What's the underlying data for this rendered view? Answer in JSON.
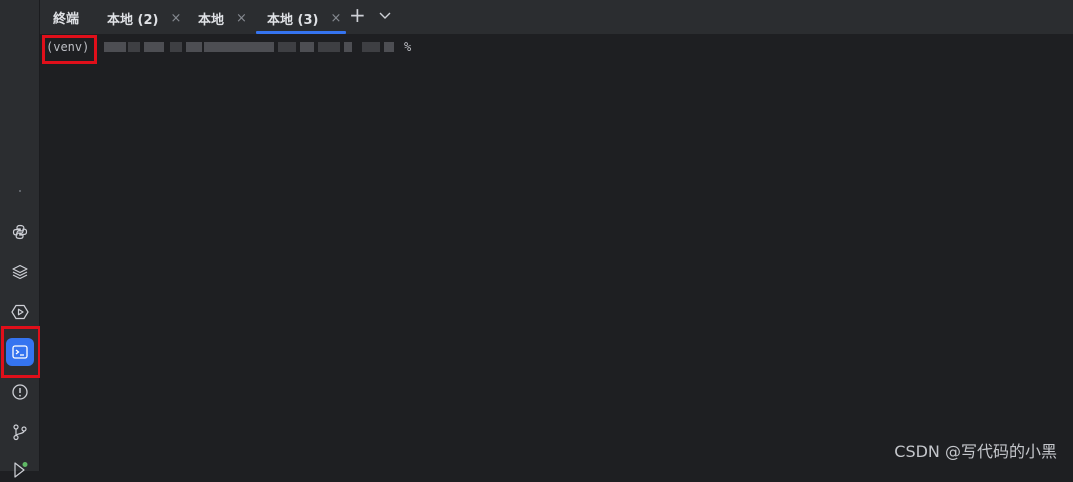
{
  "panel_title": "終端",
  "tabs": [
    {
      "label": "本地 (2)"
    },
    {
      "label": "本地"
    },
    {
      "label": "本地 (3)"
    }
  ],
  "tab_close_glyph": "×",
  "new_tab_glyph": "+",
  "prompt": {
    "venv": "(venv)",
    "suffix": "%"
  },
  "icons": [
    "python-icon",
    "layers-icon",
    "run-icon",
    "terminal-icon",
    "problems-icon",
    "git-icon",
    "deploy-icon"
  ],
  "colors": {
    "accent": "#3574f0",
    "highlight": "#e00f1a"
  },
  "watermark": "CSDN @写代码的小黑"
}
